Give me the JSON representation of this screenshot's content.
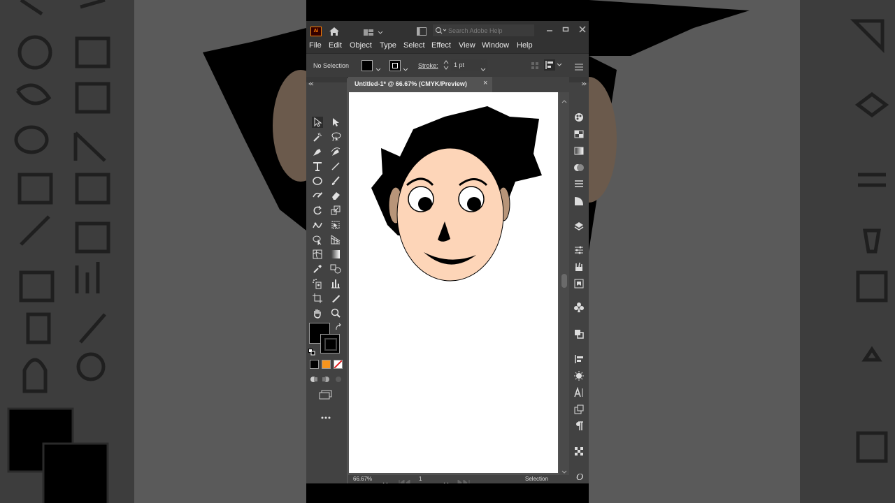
{
  "app": {
    "logo": "Ai",
    "search_placeholder": "Search Adobe Help"
  },
  "menu": [
    "File",
    "Edit",
    "Object",
    "Type",
    "Select",
    "Effect",
    "View",
    "Window",
    "Help"
  ],
  "control_bar": {
    "selection_label": "No Selection",
    "stroke_label": "Stroke:",
    "stroke_value": "1 pt"
  },
  "document_tab": {
    "title": "Untitled-1* @ 66.67% (CMYK/Preview)",
    "close": "×"
  },
  "status_bar": {
    "zoom": "66.67%",
    "artboard_number": "1",
    "tool_label": "Selection"
  },
  "colors": {
    "skin": "#fdd5b8",
    "hair": "#000000",
    "ear": "#b89579",
    "ui_dark": "#323232",
    "ui_panel": "#424242",
    "ui_canvas": "#535353",
    "swatch_orange": "#f7941d",
    "swatch_none_red": "#e02020"
  },
  "tools": [
    "selection-tool",
    "direct-selection-tool",
    "magic-wand-tool",
    "lasso-tool",
    "pen-tool",
    "curvature-tool",
    "type-tool",
    "line-tool",
    "ellipse-tool",
    "paintbrush-tool",
    "shaper-tool",
    "eraser-tool",
    "rotate-tool",
    "scale-tool",
    "puppet-warp-tool",
    "free-transform-tool",
    "shape-builder-tool",
    "perspective-grid-tool",
    "mesh-tool",
    "gradient-tool",
    "eyedropper-tool",
    "blend-tool",
    "symbol-sprayer-tool",
    "column-graph-tool",
    "artboard-tool",
    "slice-tool",
    "hand-tool",
    "zoom-tool"
  ]
}
